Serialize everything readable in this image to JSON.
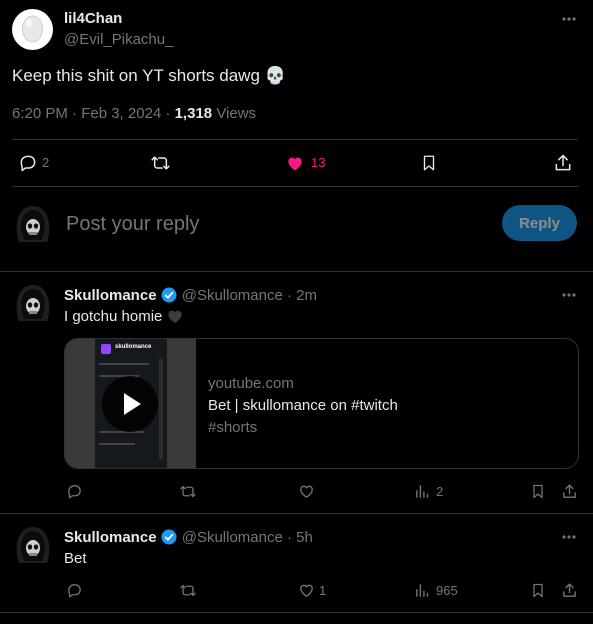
{
  "tweet": {
    "author_name": "lil4Chan",
    "author_handle": "@Evil_Pikachu_",
    "text": "Keep this shit on YT shorts dawg",
    "emoji": "💀",
    "time": "6:20 PM · Feb 3, 2024 ·",
    "views_count": "1,318",
    "views_label": "Views",
    "replies": "2",
    "likes": "13",
    "liked": true,
    "like_color": "#f91880"
  },
  "reply_box": {
    "placeholder": "Post your reply",
    "button_label": "Reply",
    "button_color": "#1d9bf0"
  },
  "replies": [
    {
      "author_name": "Skullomance",
      "author_handle": "@Skullomance",
      "time": "· 2m",
      "text": "I gotchu homie",
      "emoji": "🖤",
      "card": {
        "domain": "youtube.com",
        "title": "Bet | skullomance on #twitch",
        "subtitle": "#shorts",
        "thumb_label": "skullomance"
      },
      "views": "2"
    },
    {
      "author_name": "Skullomance",
      "author_handle": "@Skullomance",
      "time": "· 5h",
      "text": "Bet",
      "likes": "1",
      "views": "965"
    }
  ]
}
